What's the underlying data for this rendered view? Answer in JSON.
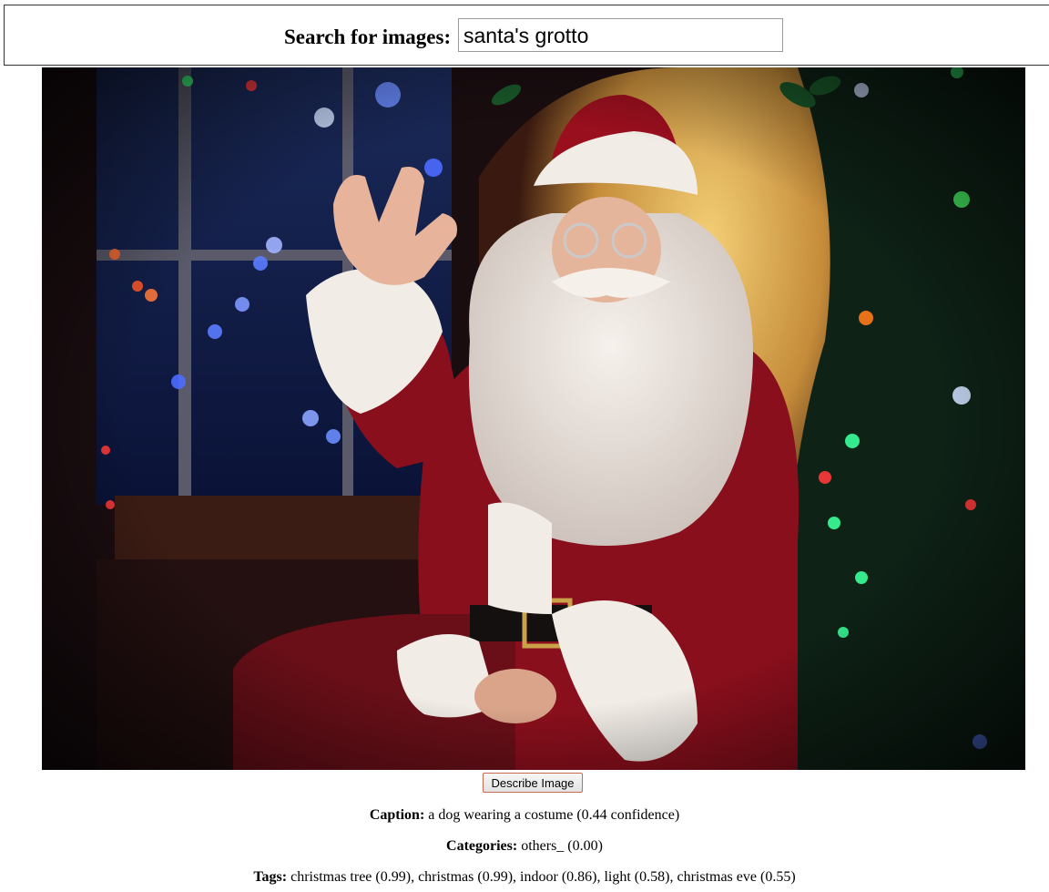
{
  "search": {
    "label": "Search for images:",
    "value": "santa's grotto"
  },
  "image": {
    "subject": "Santa Claus waving beside a window with Christmas lights"
  },
  "describe_button": {
    "label": "Describe Image"
  },
  "caption": {
    "label": "Caption:",
    "text": "a dog wearing a costume (0.44 confidence)"
  },
  "categories": {
    "label": "Categories:",
    "text": "others_ (0.00)"
  },
  "tags": {
    "label": "Tags:",
    "text": "christmas tree (0.99), christmas (0.99), indoor (0.86), light (0.58), christmas eve (0.55)"
  },
  "colors": {
    "suit_red": "#8a0f1c",
    "fur_white": "#f1ece6",
    "background_dark": "#1a0d10",
    "warm_wall": "#e6b75a"
  }
}
